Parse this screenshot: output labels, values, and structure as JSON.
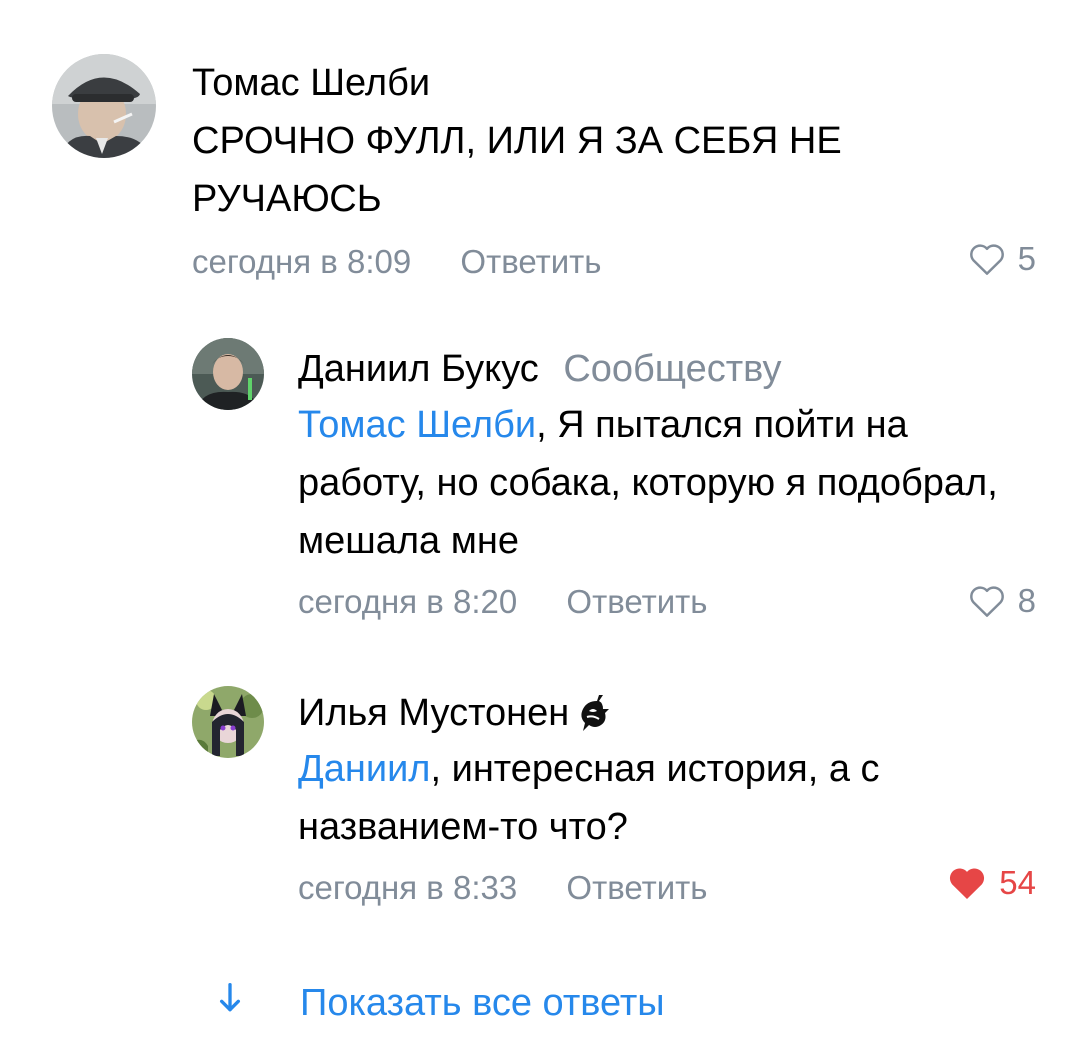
{
  "comments": [
    {
      "author": "Томас Шелби",
      "text": "СРОЧНО ФУЛЛ, ИЛИ Я ЗА СЕБЯ НЕ РУЧАЮСЬ",
      "time": "сегодня в 8:09",
      "reply_label": "Ответить",
      "likes": "5",
      "liked": false,
      "avatar": "man-in-flat-cap-avatar"
    },
    {
      "author": "Даниил Букус",
      "group": "Сообществу",
      "mention": "Томас Шелби",
      "text": ", Я пытался пойти на работу, но собака, которую я подобрал, мешала мне",
      "time": "сегодня в 8:20",
      "reply_label": "Ответить",
      "likes": "8",
      "liked": false,
      "avatar": "young-man-avatar"
    },
    {
      "author": "Илья Мустонен",
      "badge_icon": "dragon-badge-icon",
      "mention": "Даниил",
      "text": ", интересная история, а с названием-то что?",
      "time": "сегодня в 8:33",
      "reply_label": "Ответить",
      "likes": "54",
      "liked": true,
      "avatar": "anime-girl-avatar"
    }
  ],
  "show_all_replies": "Показать все ответы",
  "colors": {
    "link": "#2688eb",
    "secondary": "#818c99",
    "like_active": "#e64646"
  }
}
